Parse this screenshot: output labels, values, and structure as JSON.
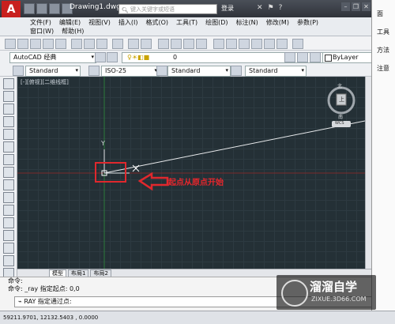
{
  "app": {
    "logo_letter": "A",
    "title": "Drawing1.dwg"
  },
  "search": {
    "placeholder": "键入关键字或短语"
  },
  "login": "登录",
  "menu_row1": [
    "文件(F)",
    "编辑(E)",
    "视图(V)",
    "插入(I)",
    "格式(O)",
    "工具(T)",
    "绘图(D)",
    "标注(N)",
    "修改(M)",
    "参数(P)"
  ],
  "menu_row2": [
    "窗口(W)",
    "帮助(H)"
  ],
  "workspace": {
    "value": "AutoCAD 经典",
    "layer": "0",
    "linetype": "ByLayer"
  },
  "styles": {
    "text_style": "Standard",
    "dim_style": "ISO-25",
    "table_style": "Standard",
    "mleader_style": "Standard"
  },
  "viewport": {
    "label": "[-][俯视][二维线框]",
    "compass_north": "北",
    "compass_south": "南",
    "compass_center": "上",
    "wcs": "WCS"
  },
  "axis_y": "Y",
  "annotation": "起点从原点开始",
  "layout_tabs": [
    "模型",
    "布局1",
    "布局2"
  ],
  "command_history": [
    "命令:",
    "命令: _ray 指定起点: 0,0"
  ],
  "command_line": "RAY 指定通过点:",
  "status_coords": "59211.9701, 12132.5403 , 0.0000",
  "right_panel": [
    "面",
    "工具",
    "方法",
    "注意"
  ],
  "watermark": {
    "title": "溜溜自学",
    "url": "ZIXUE.3D66.COM"
  },
  "colors": {
    "accent": "#c8201e",
    "canvas_bg": "#243036",
    "annotation_red": "#e8262c"
  }
}
